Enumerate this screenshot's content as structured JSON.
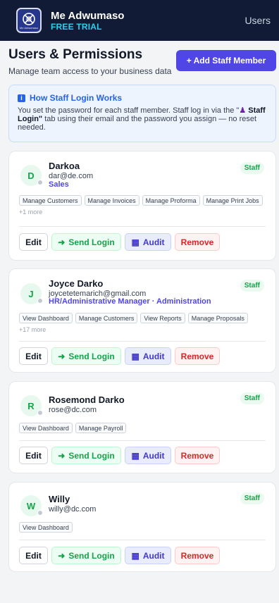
{
  "app": {
    "name": "Me Adwumaso",
    "plan": "FREE TRIAL",
    "logo_text": "Me Adwumaso",
    "nav_current": "Users"
  },
  "header": {
    "title": "Users & Permissions",
    "subtitle": "Manage team access to your business data",
    "add_button": "+ Add Staff Member"
  },
  "info": {
    "title": "How Staff Login Works",
    "text_before": "You set the password for each staff member. Staff log in via the \"",
    "text_bold": " Staff Login\"",
    "text_after": " tab using their email and the password you assign — no reset needed."
  },
  "actions": {
    "edit": "Edit",
    "send_login": "Send Login",
    "audit": "Audit",
    "remove": "Remove"
  },
  "staff": [
    {
      "initial": "D",
      "name": "Darkoa",
      "email": "dar@de.com",
      "role": "Sales",
      "badge": "Staff",
      "permissions": [
        "Manage Customers",
        "Manage Invoices",
        "Manage Proforma",
        "Manage Print Jobs"
      ],
      "more": "+1 more"
    },
    {
      "initial": "J",
      "name": "Joyce Darko",
      "email": "joycetetemarich@gmail.com",
      "role": "HR/Administrative Manager · Administration",
      "badge": "Staff",
      "permissions": [
        "View Dashboard",
        "Manage Customers",
        "View Reports",
        "Manage Proposals"
      ],
      "more": "+17 more"
    },
    {
      "initial": "R",
      "name": "Rosemond Darko",
      "email": "rose@dc.com",
      "badge": "Staff",
      "permissions": [
        "View Dashboard",
        "Manage Payroll"
      ]
    },
    {
      "initial": "W",
      "name": "Willy",
      "email": "willy@dc.com",
      "badge": "Staff",
      "permissions": [
        "View Dashboard"
      ]
    }
  ],
  "colors": {
    "topbar": "#121b35",
    "accent": "#4f46e5",
    "trial": "#22d3ee",
    "staff_badge": "#16a34a",
    "remove": "#dc2626"
  },
  "icons": {
    "logo": "logo-icon",
    "info": "info-icon",
    "send_login": "login-arrow-icon",
    "audit": "bar-chart-icon",
    "person": "person-icon"
  }
}
